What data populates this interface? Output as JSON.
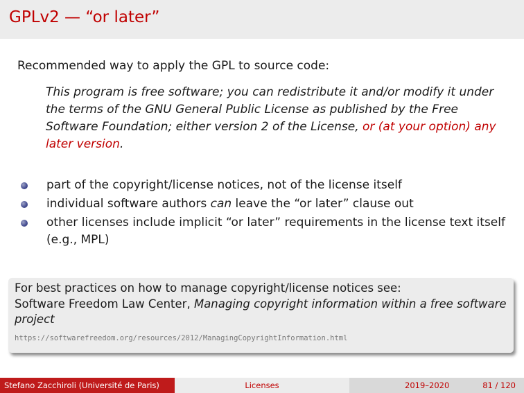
{
  "title": "GPLv2 — “or later”",
  "intro": "Recommended way to apply the GPL to source code:",
  "quote": {
    "text": "This program is free software; you can redistribute it and/or modify it under the terms of the GNU General Public License as published by the Free Software Foundation; either version 2 of the License, ",
    "highlight": "or (at your option) any later version",
    "end": "."
  },
  "bullets": [
    {
      "text": "part of the copyright/license notices, not of the license itself"
    },
    {
      "pre": "individual software authors ",
      "emph": "can",
      "post": " leave the “or later” clause out"
    },
    {
      "text": "other licenses include implicit “or later” requirements in the license text itself (e.g., MPL)"
    }
  ],
  "note": {
    "line1": "For best practices on how to manage copyright/license notices see:",
    "org": "Software Freedom Law Center, ",
    "work": "Managing copyright information within a free software project",
    "url": "https://softwarefreedom.org/resources/2012/ManagingCopyrightInformation.html"
  },
  "footer": {
    "author": "Stefano Zacchiroli  (Université de Paris)",
    "topic": "Licenses",
    "year": "2019–2020",
    "page": "81 / 120"
  },
  "colors": {
    "accent": "#c00000",
    "footer_left": "#bf1b1b",
    "box_bg": "#ececec"
  }
}
